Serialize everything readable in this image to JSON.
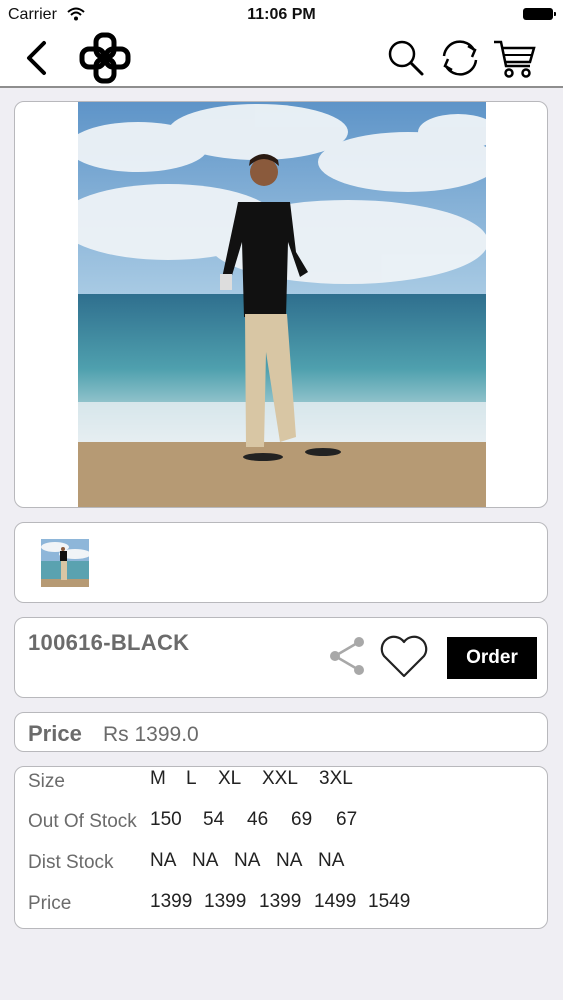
{
  "status_bar": {
    "carrier": "Carrier",
    "time": "11:06 PM"
  },
  "nav": {
    "back_icon": "chevron-left-icon",
    "logo_icon": "knot-logo-icon",
    "search_icon": "search-icon",
    "refresh_icon": "refresh-icon",
    "cart_icon": "cart-icon"
  },
  "product": {
    "code": "100616-BLACK",
    "order_label": "Order",
    "share_icon": "share-icon",
    "favorite_icon": "heart-icon"
  },
  "price": {
    "label": "Price",
    "value": "Rs 1399.0"
  },
  "stock_table": {
    "rows": [
      {
        "label": "Size",
        "values": [
          "M",
          "L",
          "XL",
          "XXL",
          "3XL"
        ]
      },
      {
        "label": "Out Of Stock",
        "values": [
          "150",
          "54",
          "46",
          "69",
          "67"
        ]
      },
      {
        "label": "Dist Stock",
        "values": [
          "NA",
          "NA",
          "NA",
          "NA",
          "NA"
        ]
      },
      {
        "label": "Price",
        "values": [
          "1399",
          "1399",
          "1399",
          "1499",
          "1549"
        ]
      }
    ]
  },
  "colors": {
    "background": "#efeef3",
    "card_border": "#b8b8bc",
    "label_gray": "#6b6b6b",
    "order_bg": "#000000"
  }
}
